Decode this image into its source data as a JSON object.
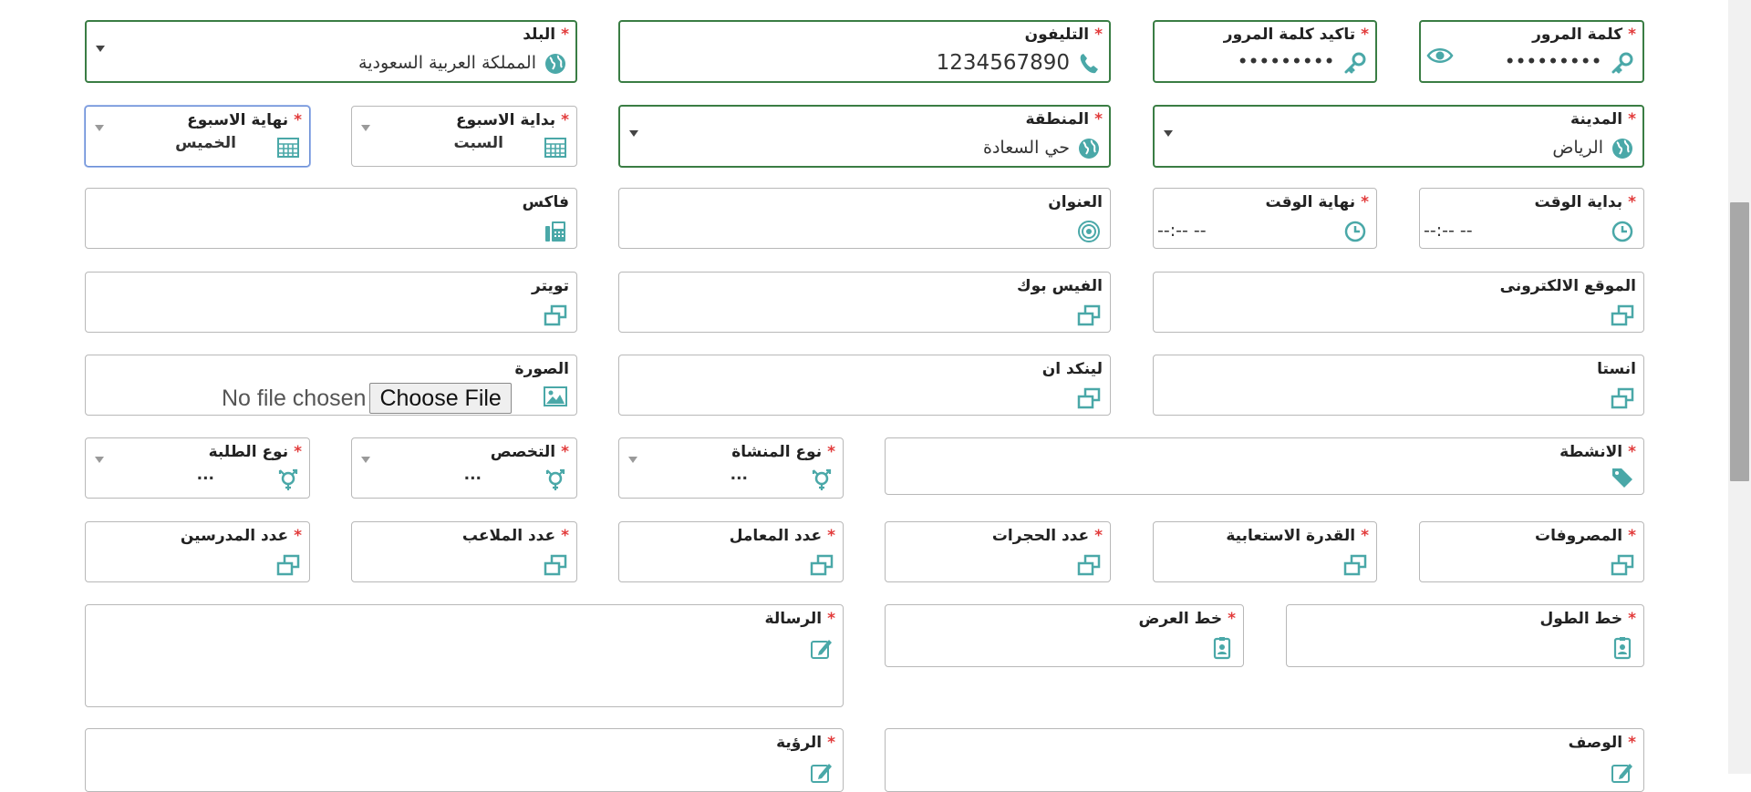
{
  "form": {
    "password": {
      "label": "كلمة المرور",
      "value": "•••••••••"
    },
    "confirm_password": {
      "label": "تاكيد كلمة المرور",
      "value": "•••••••••"
    },
    "phone": {
      "label": "التليفون",
      "value": "1234567890"
    },
    "country": {
      "label": "البلد",
      "value": "المملكة العربية السعودية"
    },
    "city": {
      "label": "المدينة",
      "value": "الرياض"
    },
    "region": {
      "label": "المنطقة",
      "value": "حي السعادة"
    },
    "week_start": {
      "label": "بداية الاسبوع",
      "value": "السبت"
    },
    "week_end": {
      "label": "نهاية الاسبوع",
      "value": "الخميس"
    },
    "time_start": {
      "label": "بداية الوقت",
      "value": "--:-- --"
    },
    "time_end": {
      "label": "نهاية الوقت",
      "value": "--:-- --"
    },
    "address": {
      "label": "العنوان"
    },
    "fax": {
      "label": "فاكس"
    },
    "website": {
      "label": "الموقع الالكترونى"
    },
    "facebook": {
      "label": "الفيس بوك"
    },
    "twitter": {
      "label": "تويتر"
    },
    "instagram": {
      "label": "انستا"
    },
    "linkedin": {
      "label": "لينكد ان"
    },
    "image": {
      "label": "الصورة",
      "button": "Choose File",
      "status": "No file chosen"
    },
    "activities": {
      "label": "الانشطة"
    },
    "facility_type": {
      "label": "نوع المنشاة",
      "value": "..."
    },
    "specialty": {
      "label": "التخصص",
      "value": "..."
    },
    "students_type": {
      "label": "نوع الطلبة",
      "value": "..."
    },
    "expenses": {
      "label": "المصروفات"
    },
    "capacity": {
      "label": "القدرة الاستعابية"
    },
    "rooms": {
      "label": "عدد الحجرات"
    },
    "labs": {
      "label": "عدد المعامل"
    },
    "courts": {
      "label": "عدد الملاعب"
    },
    "teachers": {
      "label": "عدد المدرسين"
    },
    "longitude": {
      "label": "خط الطول"
    },
    "latitude": {
      "label": "خط العرض"
    },
    "message": {
      "label": "الرسالة"
    },
    "description": {
      "label": "الوصف"
    },
    "vision": {
      "label": "الرؤية"
    }
  },
  "required_mark": "*",
  "colors": {
    "accent": "#4aa8a8",
    "valid_border": "#3a7d44",
    "required": "#e23b3b",
    "focus": "#6b8fd6"
  },
  "icons": {
    "key": "key-icon",
    "eye": "eye-icon",
    "phone": "phone-icon",
    "globe": "globe-icon",
    "calendar": "calendar-icon",
    "clock": "clock-icon",
    "target": "target-icon",
    "fax": "fax-icon",
    "link": "link-icon",
    "image": "image-icon",
    "tag": "tag-icon",
    "gender": "gender-icon",
    "badge": "badge-icon",
    "edit": "edit-icon"
  }
}
